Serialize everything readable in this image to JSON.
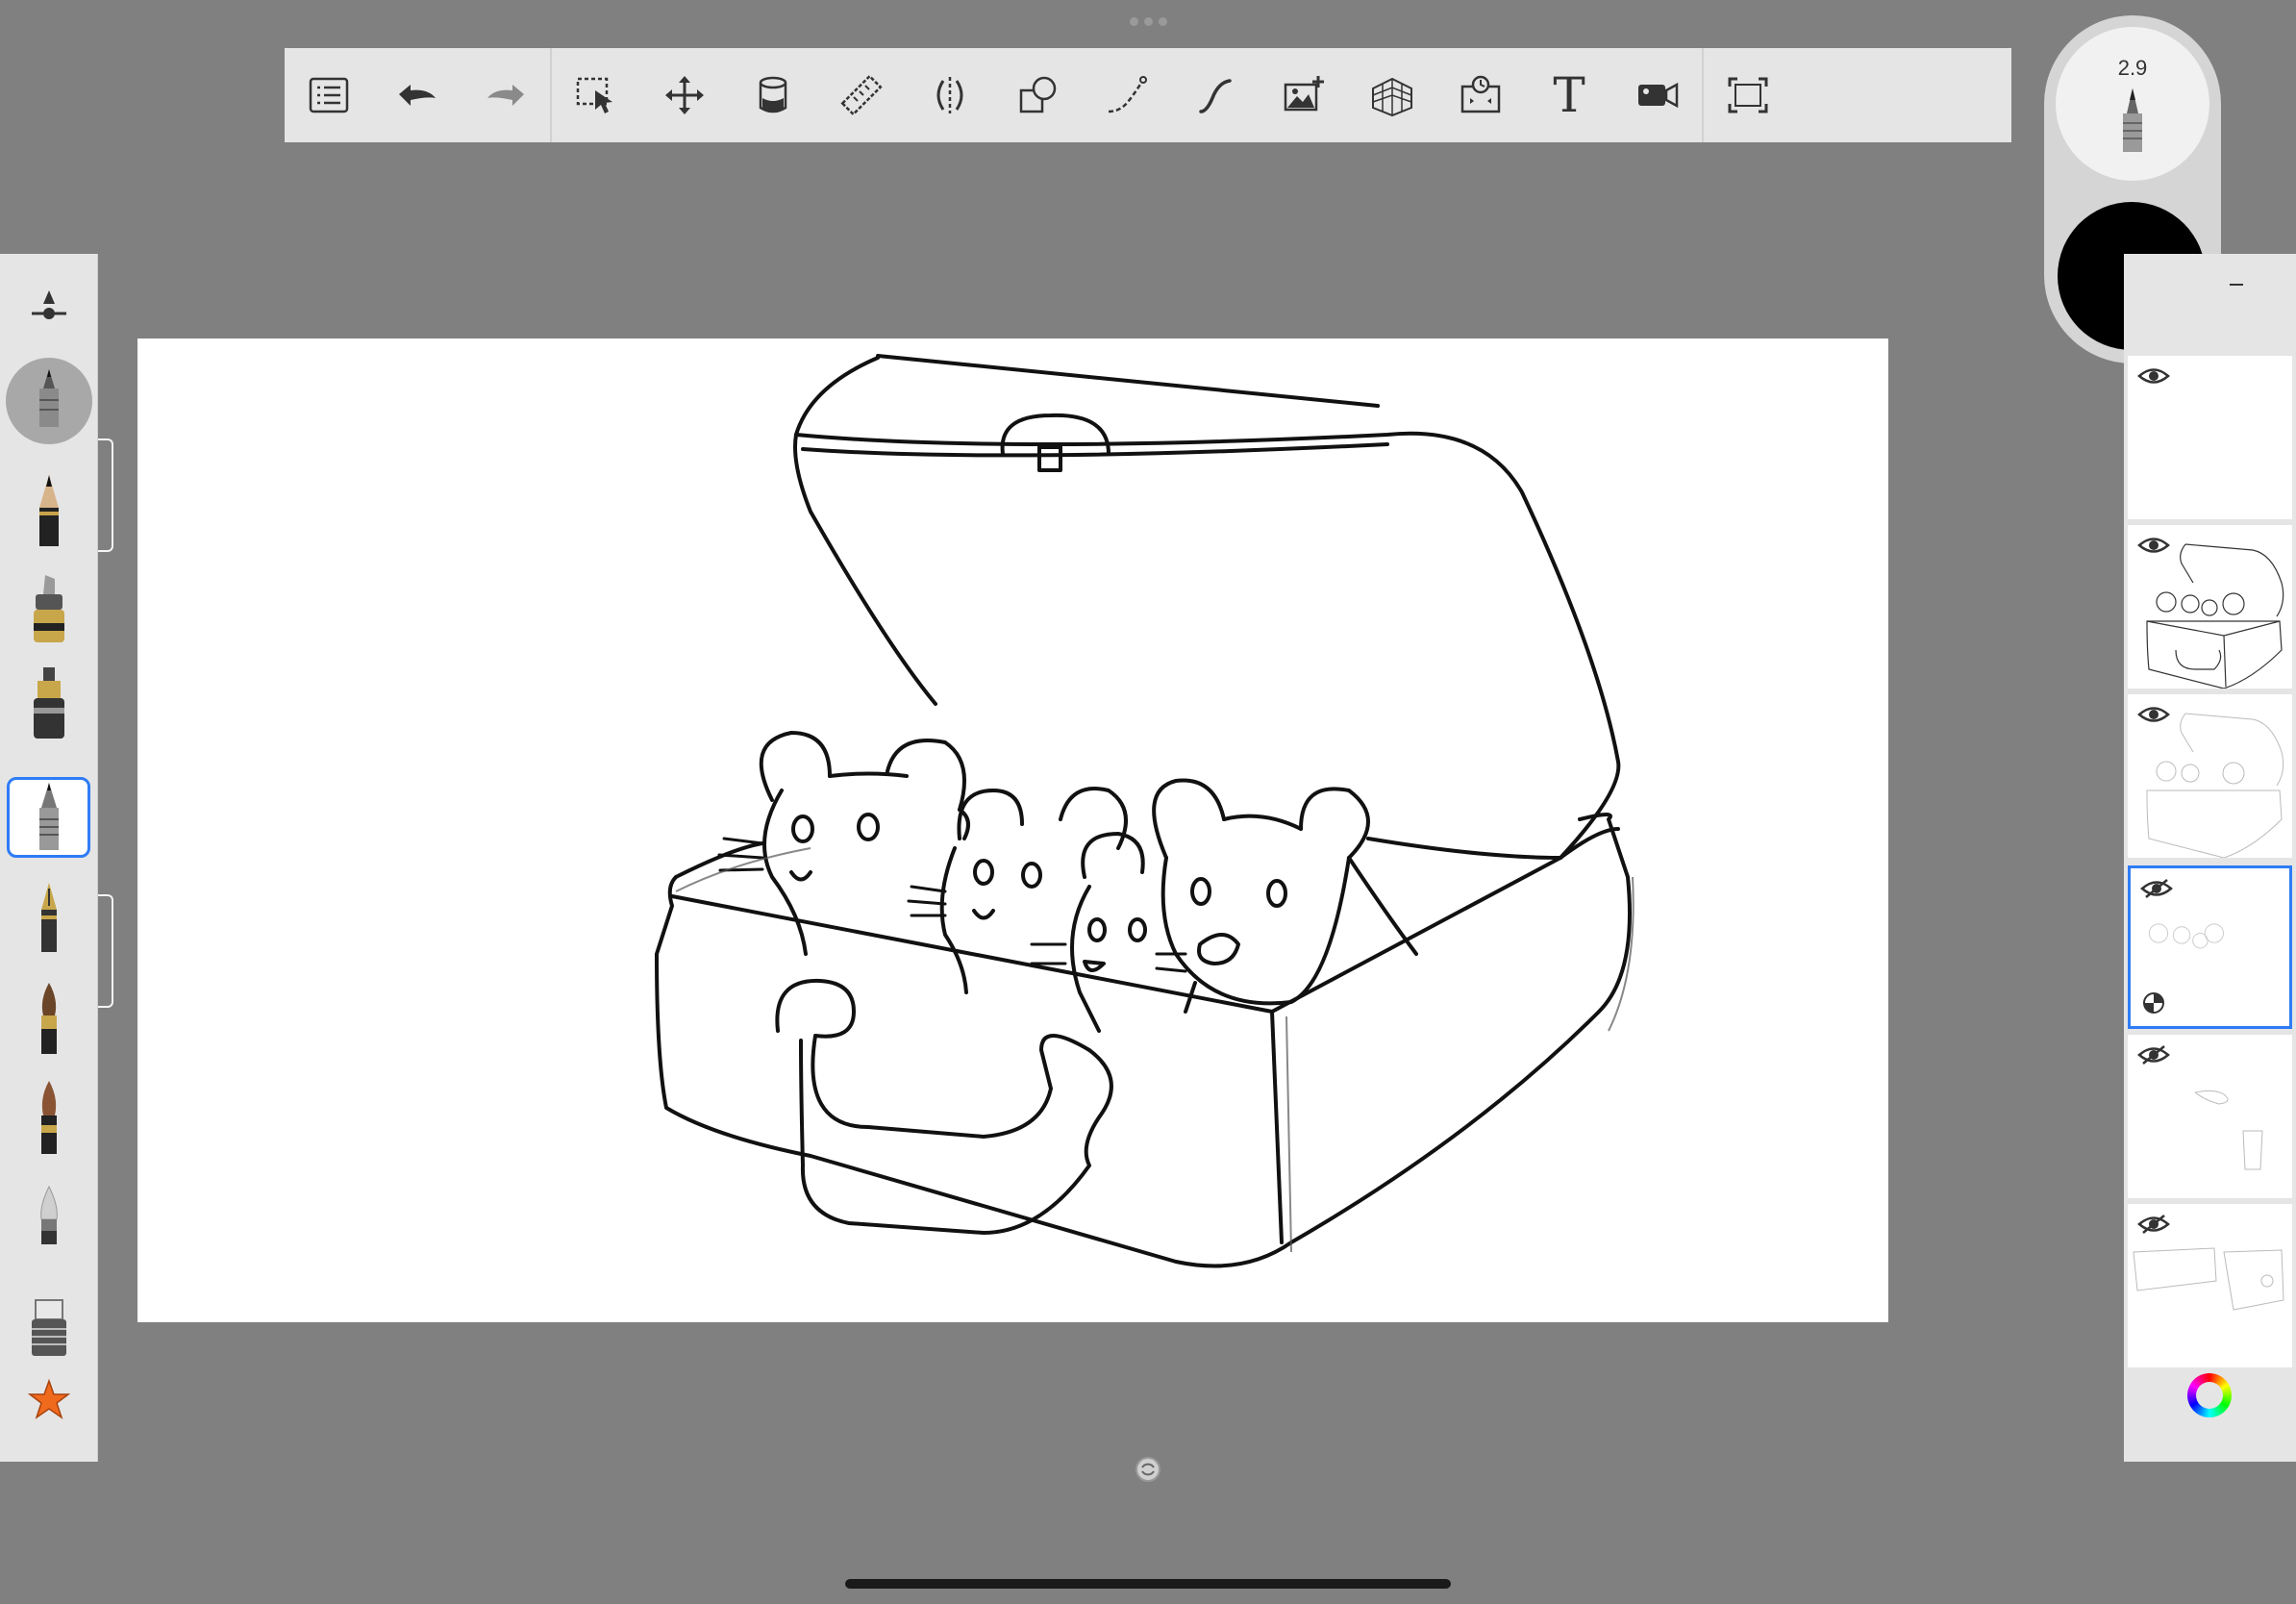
{
  "app": {
    "toolbar": {
      "tools": [
        {
          "name": "list-icon"
        },
        {
          "name": "undo-icon"
        },
        {
          "name": "redo-icon"
        },
        {
          "name": "selection-icon"
        },
        {
          "name": "transform-icon"
        },
        {
          "name": "fill-bucket-icon"
        },
        {
          "name": "ruler-icon"
        },
        {
          "name": "symmetry-icon"
        },
        {
          "name": "shapes-icon"
        },
        {
          "name": "predictive-stroke-icon"
        },
        {
          "name": "steady-stroke-icon"
        },
        {
          "name": "add-image-icon"
        },
        {
          "name": "perspective-grid-icon"
        },
        {
          "name": "time-lapse-icon"
        },
        {
          "name": "text-tool-icon",
          "label": "T"
        },
        {
          "name": "record-video-icon"
        },
        {
          "name": "fullscreen-icon"
        }
      ]
    },
    "brush_puck": {
      "size_value": "2.9",
      "color": "#000000"
    },
    "brushes": [
      "size-opacity-slider-icon",
      "current-brush-icon",
      "pencil-icon",
      "marker-icon",
      "ink-pen-icon",
      "ballpoint-pen-icon",
      "fountain-pen-icon",
      "paint-brush-icon",
      "ink-brush-icon",
      "airbrush-icon",
      "eraser-icon",
      "favorites-star-icon"
    ],
    "layers": [
      {
        "visible": true,
        "active": false,
        "content": "empty"
      },
      {
        "visible": true,
        "active": false,
        "content": "lunchbox-mice"
      },
      {
        "visible": true,
        "active": false,
        "content": "faint-lunchbox"
      },
      {
        "visible": false,
        "active": true,
        "content": "faint-mice"
      },
      {
        "visible": false,
        "active": false,
        "content": "handle-sketch"
      },
      {
        "visible": false,
        "active": false,
        "content": "box-sketch"
      }
    ],
    "colors": {
      "accent": "#2e7cf6",
      "background": "#808080",
      "panel": "#e5e5e5"
    }
  }
}
